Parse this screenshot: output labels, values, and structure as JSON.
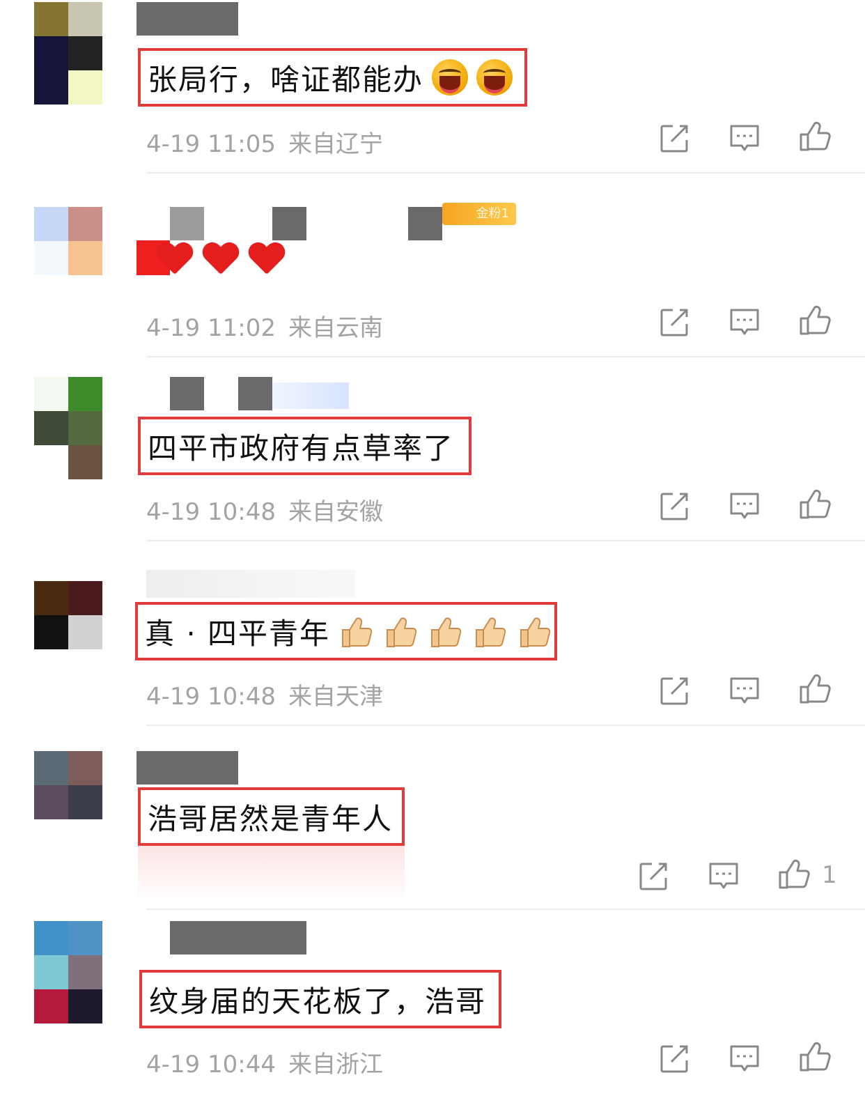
{
  "comments": [
    {
      "body": "张局行，啥证都能办",
      "emoji": [
        "laughing-emoji",
        "laughing-emoji"
      ],
      "time": "4-19 11:05",
      "location": "来自辽宁",
      "avatar_colors": [
        "#857531",
        "#c8c6b0",
        "#15143a",
        "#232323",
        "#15153a",
        "#f3f7c4"
      ],
      "like_count": ""
    },
    {
      "body": "",
      "badge": "金粉1",
      "emoji": [
        "heart",
        "heart",
        "heart"
      ],
      "time": "4-19 11:02",
      "location": "来自云南",
      "avatar_colors": [
        "#c7d7f7",
        "#c98f88",
        "#f4f9fd",
        "#f6c290"
      ],
      "like_count": ""
    },
    {
      "body": "四平市政府有点草率了",
      "time": "4-19 10:48",
      "location": "来自安徽",
      "avatar_colors": [
        "#f3f8f1",
        "#3e8b2b",
        "#404a38",
        "#556b3f",
        "#ffffff",
        "#6b5340"
      ],
      "like_count": ""
    },
    {
      "body": "真 · 四平青年",
      "emoji": [
        "thumbs-up",
        "thumbs-up",
        "thumbs-up",
        "thumbs-up",
        "thumbs-up"
      ],
      "time": "4-19 10:48",
      "location": "来自天津",
      "avatar_colors": [
        "#4a2a10",
        "#4a1a1c",
        "#111114",
        "#d1d0d3"
      ],
      "like_count": ""
    },
    {
      "body": "浩哥居然是青年人",
      "time": "",
      "location": "",
      "avatar_colors": [
        "#5b6a75",
        "#7e5c5a",
        "#5c4d5e",
        "#3c3f4a"
      ],
      "like_count": "1"
    },
    {
      "body": "纹身届的天花板了，浩哥",
      "time": "4-19 10:44",
      "location": "来自浙江",
      "avatar_colors": [
        "#4192c8",
        "#4f93c6",
        "#7ec9d4",
        "#80707c",
        "#b5193b",
        "#1c1a2c"
      ],
      "like_count": ""
    }
  ],
  "actions": {
    "share": "share-icon",
    "reply": "comment-icon",
    "like": "thumbs-up-icon"
  },
  "colors": {
    "highlight_border": "#e23b3b",
    "meta_text": "#a3a3a3",
    "badge": "#f5a623"
  }
}
